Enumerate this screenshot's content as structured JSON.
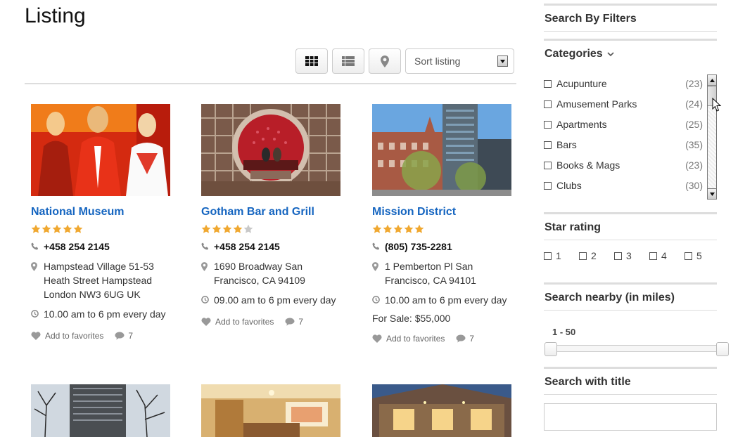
{
  "page": {
    "title": "Listing"
  },
  "toolbar": {
    "grid_icon": "grid-icon",
    "list_icon": "list-icon",
    "map_icon": "map-pin-icon",
    "sort_placeholder": "Sort listing"
  },
  "colors": {
    "link": "#1565c0",
    "star": "#f0a830",
    "star_empty": "#c8c8c8",
    "divider": "#dddddd"
  },
  "listings": [
    {
      "name": "National Museum",
      "rating": 5,
      "phone": "+458 254 2145",
      "address": [
        "Hampstead Village 51-53",
        "Heath Street Hampstead",
        "London NW3 6UG UK"
      ],
      "hours": "10.00 am to 6 pm every day",
      "sale": "",
      "favorite_label": "Add to favorites",
      "comments": "7"
    },
    {
      "name": "Gotham Bar and Grill",
      "rating": 4,
      "phone": "+458 254 2145",
      "address": [
        "1690 Broadway San",
        "Francisco, CA 94109"
      ],
      "hours": "09.00 am to 6 pm every day",
      "sale": "",
      "favorite_label": "Add to favorites",
      "comments": "7"
    },
    {
      "name": "Mission District",
      "rating": 5,
      "phone": "(805) 735-2281",
      "address": [
        "1 Pemberton Pl San",
        "Francisco, CA 94101"
      ],
      "hours": "10.00 am to 6 pm every day",
      "sale": "For Sale: $55,000",
      "favorite_label": "Add to favorites",
      "comments": "7"
    }
  ],
  "sidebar": {
    "search_filters": "Search By Filters",
    "categories_heading": "Categories",
    "categories": [
      {
        "label": "Acupunture",
        "count": "(23)"
      },
      {
        "label": "Amusement Parks",
        "count": "(24)"
      },
      {
        "label": "Apartments",
        "count": "(25)"
      },
      {
        "label": "Bars",
        "count": "(35)"
      },
      {
        "label": "Books & Mags",
        "count": "(23)"
      },
      {
        "label": "Clubs",
        "count": "(30)"
      }
    ],
    "star_heading": "Star rating",
    "star_options": [
      "1",
      "2",
      "3",
      "4",
      "5"
    ],
    "nearby_heading": "Search nearby (in miles)",
    "range_label": "1 - 50",
    "range": {
      "min": 1,
      "max": 50
    },
    "title_heading": "Search with title",
    "title_value": ""
  }
}
